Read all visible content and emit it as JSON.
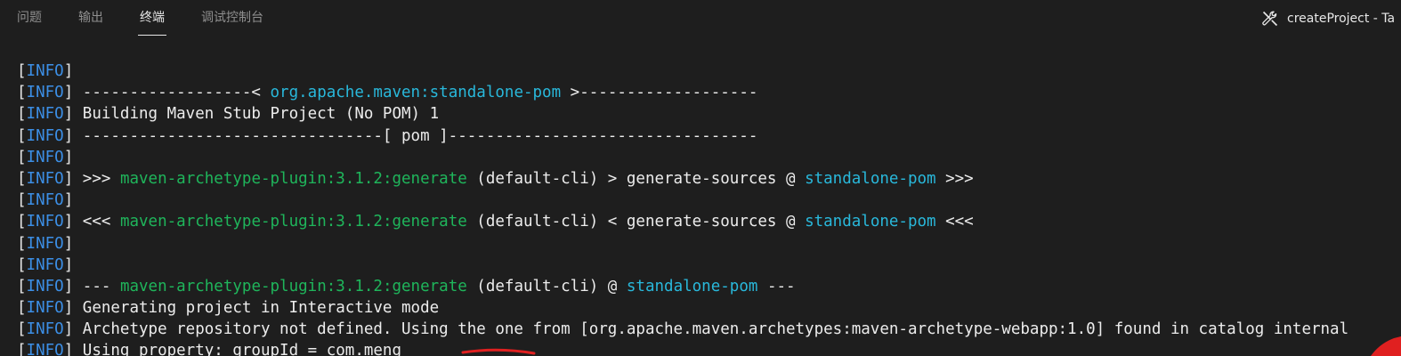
{
  "tabs": [
    {
      "label": "问题"
    },
    {
      "label": "输出"
    },
    {
      "label": "终端"
    },
    {
      "label": "调试控制台"
    }
  ],
  "active_tab": "终端",
  "task": {
    "label": "createProject - Ta",
    "icon": "tools-icon"
  },
  "colors": {
    "level": "#3c8fe6",
    "green": "#1fb55b",
    "blue": "#29b8db",
    "background": "#1e1e1e",
    "annotation": "#e02020"
  },
  "terminal": {
    "lines": [
      {
        "level": "INFO",
        "segments": []
      },
      {
        "level": "INFO",
        "segments": [
          {
            "text": " ------------------< ",
            "color": "normal"
          },
          {
            "text": "org.apache.maven:standalone-pom",
            "color": "blue"
          },
          {
            "text": " >-------------------",
            "color": "normal"
          }
        ]
      },
      {
        "level": "INFO",
        "segments": [
          {
            "text": " Building Maven Stub Project (No POM) 1",
            "color": "normal"
          }
        ]
      },
      {
        "level": "INFO",
        "segments": [
          {
            "text": " --------------------------------[ pom ]---------------------------------",
            "color": "normal"
          }
        ]
      },
      {
        "level": "INFO",
        "segments": []
      },
      {
        "level": "INFO",
        "segments": [
          {
            "text": " >>> ",
            "color": "normal"
          },
          {
            "text": "maven-archetype-plugin:3.1.2:generate",
            "color": "green"
          },
          {
            "text": " (default-cli) > generate-sources @ ",
            "color": "normal"
          },
          {
            "text": "standalone-pom",
            "color": "blue"
          },
          {
            "text": " >>>",
            "color": "normal"
          }
        ]
      },
      {
        "level": "INFO",
        "segments": []
      },
      {
        "level": "INFO",
        "segments": [
          {
            "text": " <<< ",
            "color": "normal"
          },
          {
            "text": "maven-archetype-plugin:3.1.2:generate",
            "color": "green"
          },
          {
            "text": " (default-cli) < generate-sources @ ",
            "color": "normal"
          },
          {
            "text": "standalone-pom",
            "color": "blue"
          },
          {
            "text": " <<<",
            "color": "normal"
          }
        ]
      },
      {
        "level": "INFO",
        "segments": []
      },
      {
        "level": "INFO",
        "segments": []
      },
      {
        "level": "INFO",
        "segments": [
          {
            "text": " --- ",
            "color": "normal"
          },
          {
            "text": "maven-archetype-plugin:3.1.2:generate",
            "color": "green"
          },
          {
            "text": " (default-cli) @ ",
            "color": "normal"
          },
          {
            "text": "standalone-pom",
            "color": "blue"
          },
          {
            "text": " ---",
            "color": "normal"
          }
        ]
      },
      {
        "level": "INFO",
        "segments": [
          {
            "text": " Generating project in Interactive mode",
            "color": "normal"
          }
        ]
      },
      {
        "level": "INFO",
        "segments": [
          {
            "text": " Archetype repository not defined. Using the one from [org.apache.maven.archetypes:maven-archetype-webapp:1.0] found in catalog internal",
            "color": "normal"
          }
        ]
      },
      {
        "level": "INFO",
        "segments": [
          {
            "text": " Using property: groupId = com.meng",
            "color": "normal"
          }
        ]
      }
    ]
  }
}
